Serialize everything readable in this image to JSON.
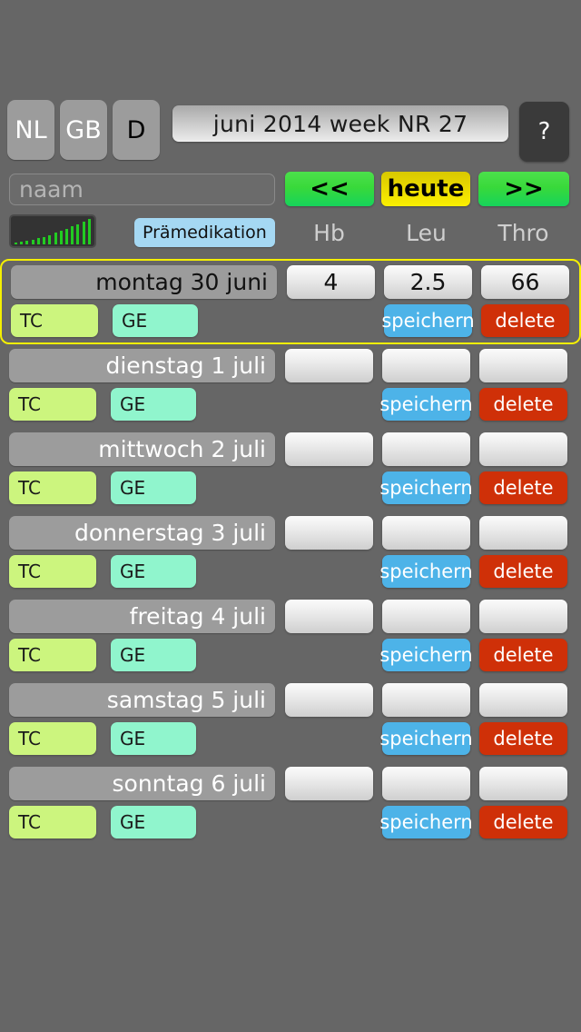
{
  "app": {
    "background_color": "#666666",
    "accent_highlight_color": "#f5f000"
  },
  "topbar": {
    "languages": [
      {
        "code": "NL",
        "name": "language-nl",
        "selected": false
      },
      {
        "code": "GB",
        "name": "language-gb",
        "selected": false
      },
      {
        "code": "D",
        "name": "language-de",
        "selected": true
      }
    ],
    "title": "juni 2014 week NR 27",
    "help_label": "?"
  },
  "toolbar": {
    "name_placeholder": "naam",
    "name_value": "",
    "prev_label": "<<",
    "today_label": "heute",
    "next_label": ">>",
    "chart_icon": "bar-chart-icon",
    "premedication_label": "Prämedikation",
    "column_headers": [
      "Hb",
      "Leu",
      "Thro"
    ]
  },
  "rows": [
    {
      "date": "montag 30 juni",
      "active": true,
      "hb": "4",
      "leu": "2.5",
      "thro": "66",
      "tc_label": "TC",
      "ge_label": "GE",
      "save_label": "speichern",
      "delete_label": "delete"
    },
    {
      "date": "dienstag 1 juli",
      "active": false,
      "hb": "",
      "leu": "",
      "thro": "",
      "tc_label": "TC",
      "ge_label": "GE",
      "save_label": "speichern",
      "delete_label": "delete"
    },
    {
      "date": "mittwoch 2 juli",
      "active": false,
      "hb": "",
      "leu": "",
      "thro": "",
      "tc_label": "TC",
      "ge_label": "GE",
      "save_label": "speichern",
      "delete_label": "delete"
    },
    {
      "date": "donnerstag 3 juli",
      "active": false,
      "hb": "",
      "leu": "",
      "thro": "",
      "tc_label": "TC",
      "ge_label": "GE",
      "save_label": "speichern",
      "delete_label": "delete"
    },
    {
      "date": "freitag 4 juli",
      "active": false,
      "hb": "",
      "leu": "",
      "thro": "",
      "tc_label": "TC",
      "ge_label": "GE",
      "save_label": "speichern",
      "delete_label": "delete"
    },
    {
      "date": "samstag 5 juli",
      "active": false,
      "hb": "",
      "leu": "",
      "thro": "",
      "tc_label": "TC",
      "ge_label": "GE",
      "save_label": "speichern",
      "delete_label": "delete"
    },
    {
      "date": "sonntag 6 juli",
      "active": false,
      "hb": "",
      "leu": "",
      "thro": "",
      "tc_label": "TC",
      "ge_label": "GE",
      "save_label": "speichern",
      "delete_label": "delete"
    }
  ]
}
